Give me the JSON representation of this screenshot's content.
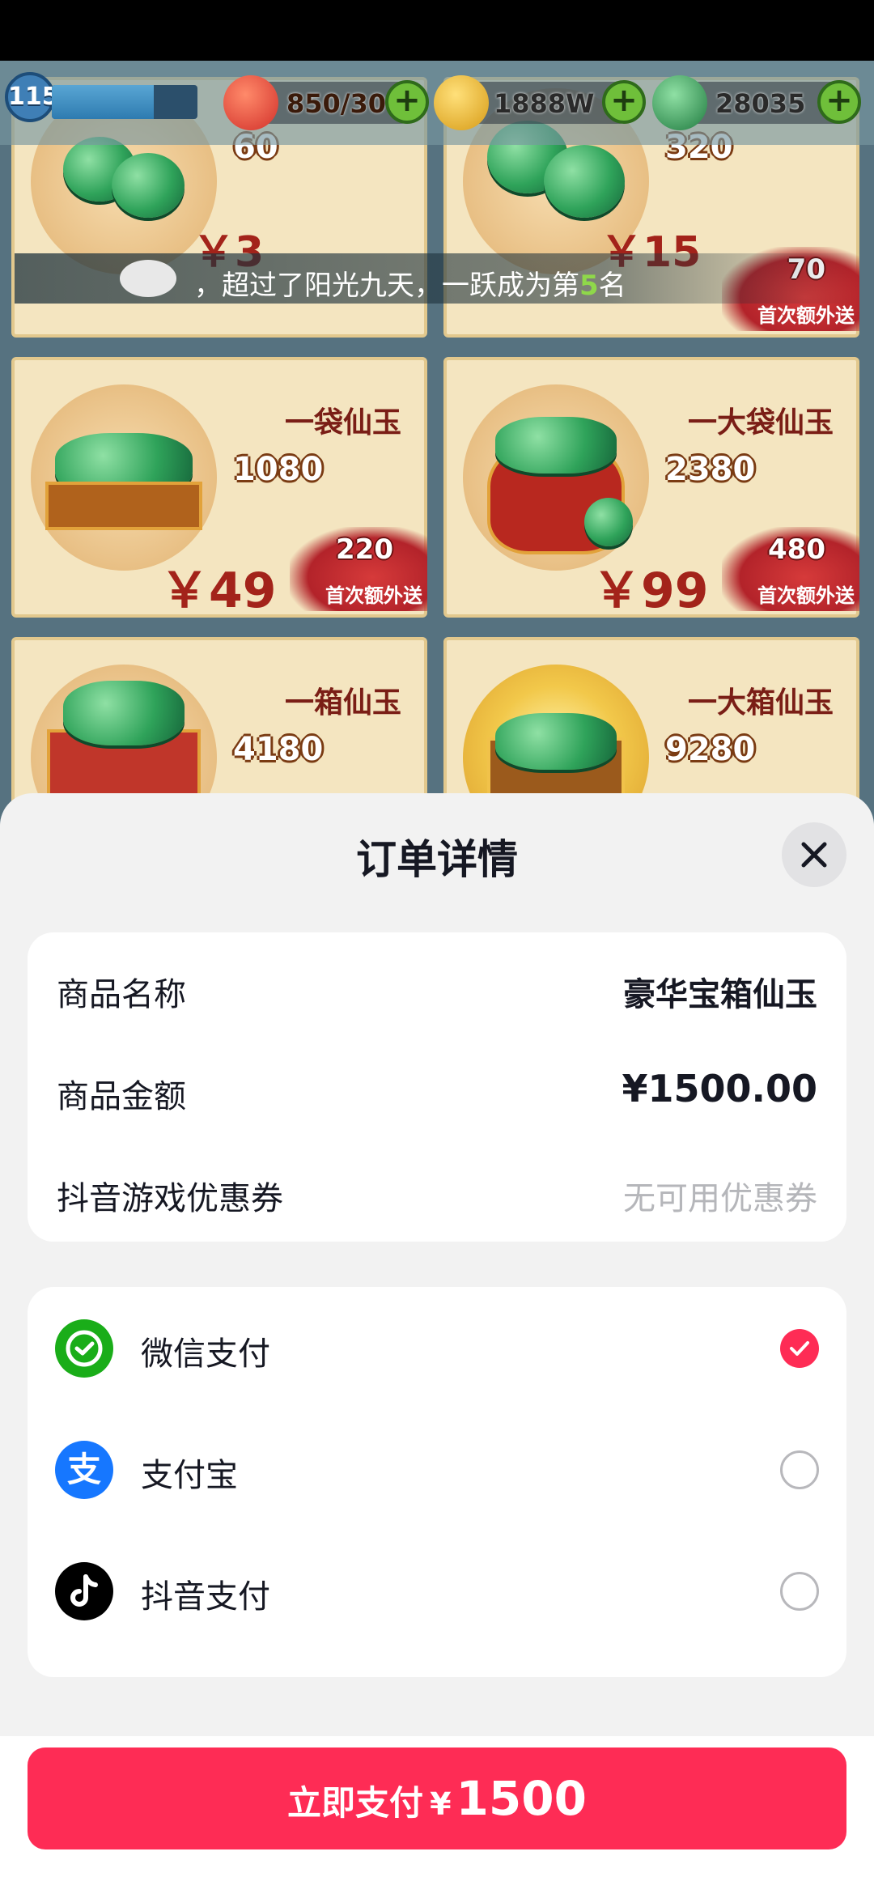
{
  "hud": {
    "level": "115",
    "stamina": "850/30",
    "coins": "1888W",
    "jade": "28035"
  },
  "ticker": {
    "prefix": "，超过了阳光九天，一跃成为第",
    "rank": "5",
    "suffix": "名"
  },
  "shop_cards": [
    {
      "name": "",
      "count": "60",
      "price": "￥3",
      "bonus": "",
      "bonus_text": ""
    },
    {
      "name": "",
      "count": "320",
      "price": "￥15",
      "bonus": "70",
      "bonus_text": "首次额外送"
    },
    {
      "name": "一袋仙玉",
      "count": "1080",
      "price": "￥49",
      "bonus": "220",
      "bonus_text": "首次额外送"
    },
    {
      "name": "一大袋仙玉",
      "count": "2380",
      "price": "￥99",
      "bonus": "480",
      "bonus_text": "首次额外送"
    },
    {
      "name": "一箱仙玉",
      "count": "4180",
      "price": "",
      "bonus": "",
      "bonus_text": ""
    },
    {
      "name": "一大箱仙玉",
      "count": "9280",
      "price": "",
      "bonus": "",
      "bonus_text": ""
    }
  ],
  "order": {
    "title": "订单详情",
    "product_name_label": "商品名称",
    "product_name_value": "豪华宝箱仙玉",
    "product_amount_label": "商品金额",
    "product_amount_value": "¥1500.00",
    "coupon_label": "抖音游戏优惠券",
    "coupon_value": "无可用优惠券"
  },
  "payment_methods": [
    {
      "label": "微信支付",
      "selected": true,
      "color": "#1aad19"
    },
    {
      "label": "支付宝",
      "selected": false,
      "color": "#1677ff"
    },
    {
      "label": "抖音支付",
      "selected": false,
      "color": "#000000"
    }
  ],
  "pay_button": {
    "label": "立即支付",
    "currency": "¥",
    "amount": "1500"
  },
  "colors": {
    "accent": "#fe2c55"
  }
}
